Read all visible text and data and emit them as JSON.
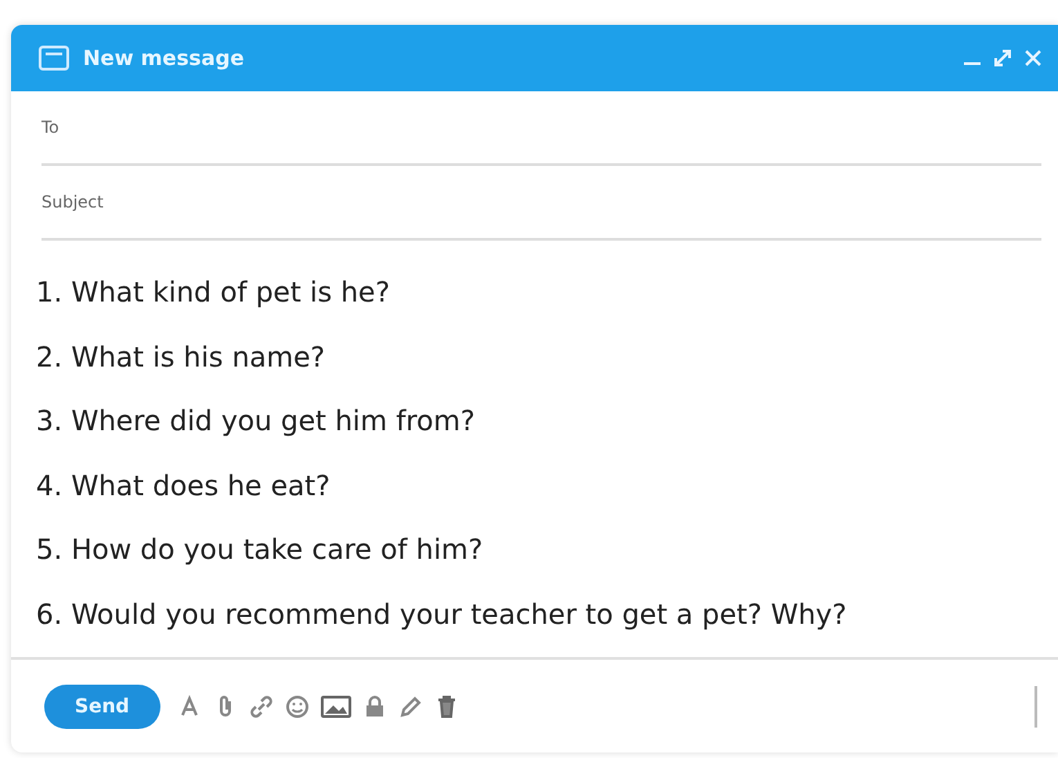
{
  "window": {
    "title": "New message"
  },
  "fields": [
    {
      "label": "To"
    },
    {
      "label": "Subject"
    }
  ],
  "body_lines": [
    "1. What kind of pet is he?",
    "2. What is his name?",
    "3. Where did you get him from?",
    "4. What does he eat?",
    "5. How do you take care of him?",
    "6. Would you recommend your teacher to get a pet? Why?"
  ],
  "send_button": {
    "label": "Send"
  }
}
